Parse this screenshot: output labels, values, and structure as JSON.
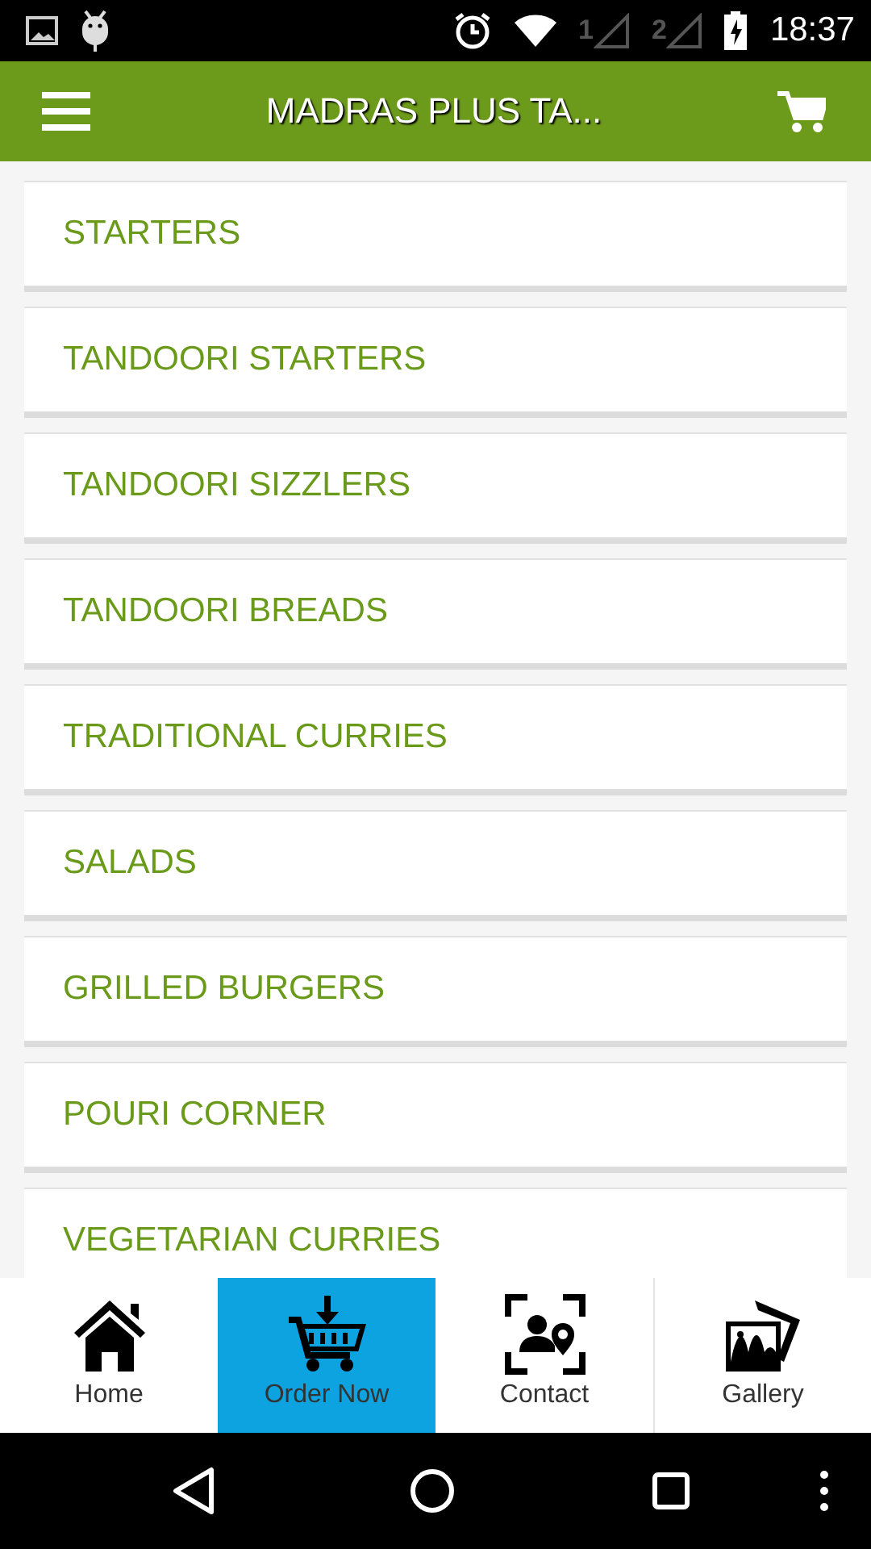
{
  "status_bar": {
    "sim_labels": [
      "1",
      "2"
    ],
    "time": "18:37"
  },
  "app_bar": {
    "title": "MADRAS PLUS TA..."
  },
  "categories": [
    {
      "label": "STARTERS"
    },
    {
      "label": "TANDOORI STARTERS"
    },
    {
      "label": "TANDOORI SIZZLERS"
    },
    {
      "label": "TANDOORI BREADS"
    },
    {
      "label": "TRADITIONAL CURRIES"
    },
    {
      "label": "SALADS"
    },
    {
      "label": "GRILLED BURGERS"
    },
    {
      "label": "POURI CORNER"
    },
    {
      "label": "VEGETARIAN CURRIES"
    }
  ],
  "bottom_nav": [
    {
      "kind": "home",
      "label": "Home",
      "selected": false
    },
    {
      "kind": "order",
      "label": "Order Now",
      "selected": true
    },
    {
      "kind": "contact",
      "label": "Contact",
      "selected": false
    },
    {
      "kind": "gallery",
      "label": "Gallery",
      "selected": false
    }
  ]
}
